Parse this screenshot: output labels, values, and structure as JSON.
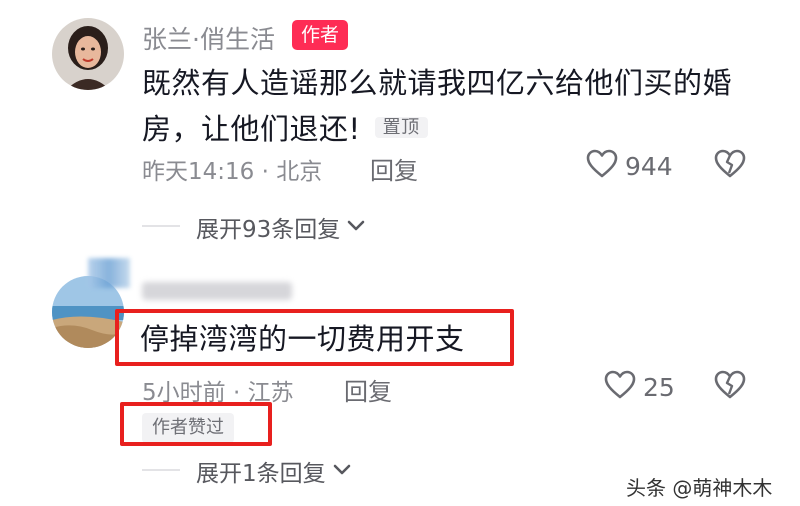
{
  "comments": [
    {
      "username": "张兰·俏生活",
      "author_tag": "作者",
      "text": "既然有人造谣那么就请我四亿六给他们买的婚房，让他们退还!",
      "pinned_label": "置顶",
      "time_location": "昨天14:16 · 北京",
      "reply_label": "回复",
      "like_count": "944",
      "expand_label": "展开93条回复"
    },
    {
      "username": "",
      "text": "停掉湾湾的一切费用开支",
      "time_location": "5小时前 · 江苏",
      "reply_label": "回复",
      "like_count": "25",
      "author_liked_label": "作者赞过",
      "expand_label": "展开1条回复"
    }
  ],
  "watermark": "头条 @萌神木木",
  "colors": {
    "author_tag": "#fe2c55",
    "highlight_box": "#e8201e",
    "meta_text": "#8a8b91"
  },
  "icons": [
    "heart-outline-icon",
    "broken-heart-icon",
    "chevron-down-icon"
  ]
}
